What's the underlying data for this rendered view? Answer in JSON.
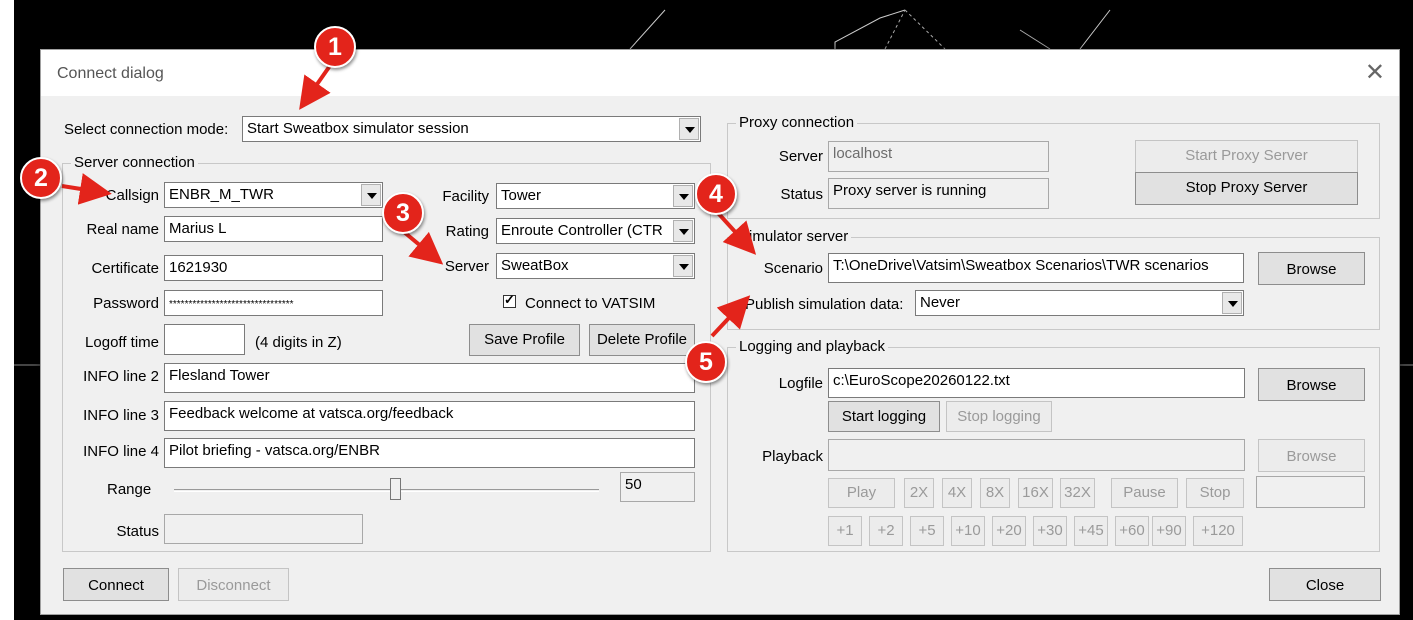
{
  "dialog": {
    "title": "Connect dialog",
    "close_icon": "close-icon"
  },
  "mode": {
    "label": "Select connection mode:",
    "value": "Start Sweatbox simulator session"
  },
  "server_connection": {
    "title": "Server connection",
    "callsign_label": "Callsign",
    "callsign": "ENBR_M_TWR",
    "realname_label": "Real name",
    "realname": "Marius L",
    "certificate_label": "Certificate",
    "certificate": "1621930",
    "password_label": "Password",
    "password": "********************************",
    "logoff_label": "Logoff time",
    "logoff": "",
    "logoff_hint": "(4 digits in Z)",
    "facility_label": "Facility",
    "facility": "Tower",
    "rating_label": "Rating",
    "rating": "Enroute Controller (CTR",
    "server_label": "Server",
    "server": "SweatBox",
    "vatsim_checkbox": "Connect to VATSIM",
    "vatsim_checked": true,
    "save_profile": "Save Profile",
    "delete_profile": "Delete Profile",
    "info2_label": "INFO line 2",
    "info2": "Flesland Tower",
    "info3_label": "INFO line 3",
    "info3": "Feedback welcome at vatsca.org/feedback",
    "info4_label": "INFO line 4",
    "info4": "Pilot briefing - vatsca.org/ENBR",
    "range_label": "Range",
    "range": "50",
    "range_fraction": 0.52,
    "status_label": "Status",
    "status": ""
  },
  "proxy": {
    "title": "Proxy connection",
    "server_label": "Server",
    "server": "localhost",
    "status_label": "Status",
    "status": "Proxy server is running",
    "start_btn": "Start Proxy Server",
    "stop_btn": "Stop Proxy Server"
  },
  "simulator": {
    "title": "Simulator server",
    "scenario_label": "Scenario",
    "scenario": "T:\\OneDrive\\Vatsim\\Sweatbox Scenarios\\TWR scenarios",
    "browse": "Browse",
    "publish_label": "Publish simulation data:",
    "publish": "Never"
  },
  "logging": {
    "title": "Logging and playback",
    "logfile_label": "Logfile",
    "logfile": "c:\\EuroScope20260122.txt",
    "browse": "Browse",
    "start_logging": "Start logging",
    "stop_logging": "Stop logging",
    "playback_label": "Playback",
    "playback": "",
    "playback_browse": "Browse",
    "play": "Play",
    "x2": "2X",
    "x4": "4X",
    "x8": "8X",
    "x16": "16X",
    "x32": "32X",
    "pause": "Pause",
    "stop": "Stop",
    "skip": [
      "+1",
      "+2",
      "+5",
      "+10",
      "+20",
      "+30",
      "+45",
      "+60",
      "+90",
      "+120"
    ]
  },
  "footer": {
    "connect": "Connect",
    "disconnect": "Disconnect",
    "close": "Close"
  },
  "annotations": [
    "1",
    "2",
    "3",
    "4",
    "5"
  ],
  "colors": {
    "badge": "#e3241b",
    "background": "#000000",
    "dialog": "#f0f0f0"
  }
}
